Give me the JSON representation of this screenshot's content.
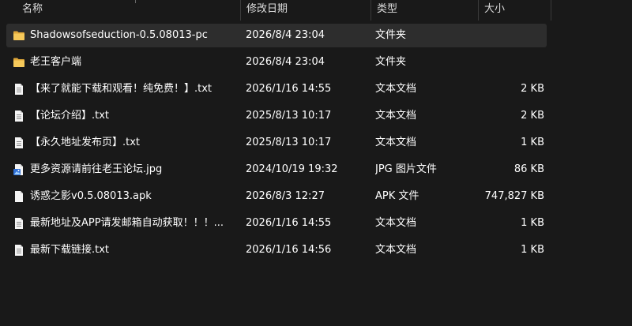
{
  "columns": {
    "name": "名称",
    "date": "修改日期",
    "type": "类型",
    "size": "大小"
  },
  "files": [
    {
      "name": "Shadowsofseduction-0.5.08013-pc",
      "date": "2026/8/4 23:04",
      "type": "文件夹",
      "size": "",
      "icon": "folder-icon",
      "selected": true
    },
    {
      "name": "老王客户端",
      "date": "2026/8/4 23:04",
      "type": "文件夹",
      "size": "",
      "icon": "folder-icon",
      "selected": false
    },
    {
      "name": "【来了就能下载和观看！纯免费！】.txt",
      "date": "2026/1/16 14:55",
      "type": "文本文档",
      "size": "2 KB",
      "icon": "text-file-icon",
      "selected": false
    },
    {
      "name": "【论坛介绍】.txt",
      "date": "2025/8/13 10:17",
      "type": "文本文档",
      "size": "2 KB",
      "icon": "text-file-icon",
      "selected": false
    },
    {
      "name": "【永久地址发布页】.txt",
      "date": "2025/8/13 10:17",
      "type": "文本文档",
      "size": "1 KB",
      "icon": "text-file-icon",
      "selected": false
    },
    {
      "name": "更多资源请前往老王论坛.jpg",
      "date": "2024/10/19 19:32",
      "type": "JPG 图片文件",
      "size": "86 KB",
      "icon": "image-file-icon",
      "selected": false
    },
    {
      "name": "诱惑之影v0.5.08013.apk",
      "date": "2026/8/3 12:27",
      "type": "APK 文件",
      "size": "747,827 KB",
      "icon": "file-icon",
      "selected": false
    },
    {
      "name": "最新地址及APP请发邮箱自动获取！！！...",
      "date": "2026/1/16 14:55",
      "type": "文本文档",
      "size": "1 KB",
      "icon": "text-file-icon",
      "selected": false
    },
    {
      "name": "最新下载链接.txt",
      "date": "2026/1/16 14:56",
      "type": "文本文档",
      "size": "1 KB",
      "icon": "text-file-icon",
      "selected": false
    }
  ],
  "colors": {
    "background": "#191919",
    "selected_row": "#2d2d2d",
    "folder": "#f3c24f",
    "text": "#ffffff"
  }
}
